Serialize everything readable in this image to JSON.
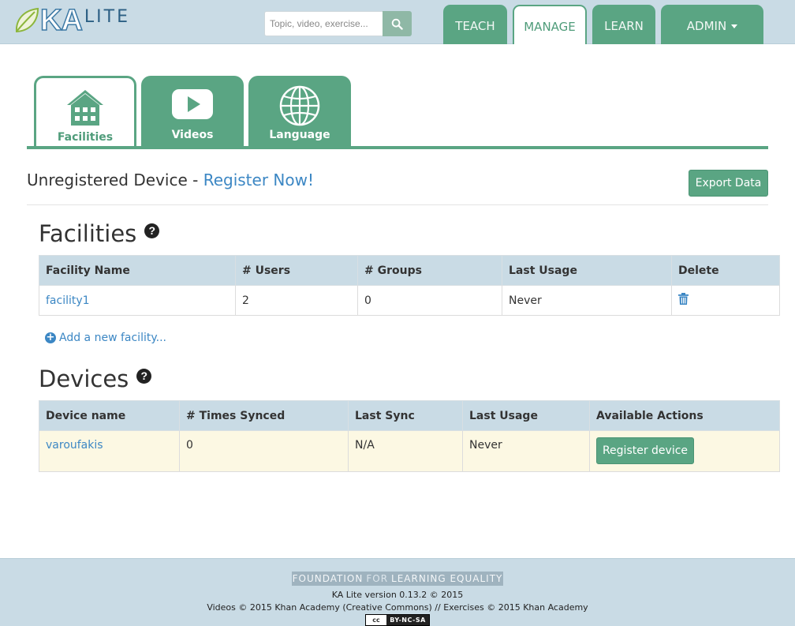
{
  "header": {
    "logo_ka": "KA",
    "logo_lite": "LITE",
    "search": {
      "placeholder": "Topic, video, exercise...",
      "button_icon": "search-icon"
    },
    "nav": [
      {
        "label": "TEACH",
        "active": false
      },
      {
        "label": "MANAGE",
        "active": true
      },
      {
        "label": "LEARN",
        "active": false
      },
      {
        "label": "ADMIN",
        "active": false,
        "dropdown": true
      }
    ]
  },
  "section_tabs": [
    {
      "label": "Facilities",
      "icon": "building-icon",
      "active": true
    },
    {
      "label": "Videos",
      "icon": "play-icon",
      "active": false
    },
    {
      "label": "Language",
      "icon": "globe-icon",
      "active": false
    }
  ],
  "device_status": {
    "text": "Unregistered Device - ",
    "link": "Register Now!"
  },
  "export_button": "Export Data",
  "facilities": {
    "title": "Facilities",
    "headers": [
      "Facility Name",
      "# Users",
      "# Groups",
      "Last Usage",
      "Delete"
    ],
    "rows": [
      {
        "name": "facility1",
        "users": "2",
        "groups": "0",
        "last_usage": "Never",
        "delete_icon": "trash-icon"
      }
    ],
    "add_link": "Add a new facility..."
  },
  "devices": {
    "title": "Devices",
    "headers": [
      "Device name",
      "# Times Synced",
      "Last Sync",
      "Last Usage",
      "Available Actions"
    ],
    "rows": [
      {
        "name": "varoufakis",
        "times_synced": "0",
        "last_sync": "N/A",
        "last_usage": "Never",
        "action": "Register device"
      }
    ]
  },
  "footer": {
    "org_part1": "FOUNDATION",
    "org_part2": "FOR",
    "org_part3": "LEARNING EQUALITY",
    "version": "KA Lite version 0.13.2 © 2015",
    "credits": "Videos © 2015 Khan Academy (Creative Commons) // Exercises © 2015 Khan Academy",
    "license_badge_left": "cc",
    "license_badge": "BY-NC-SA"
  },
  "colors": {
    "brand_green": "#5aa583",
    "header_blue": "#c9dbe5",
    "link_blue": "#3c87c4",
    "warning_row": "#fcf8e3"
  }
}
